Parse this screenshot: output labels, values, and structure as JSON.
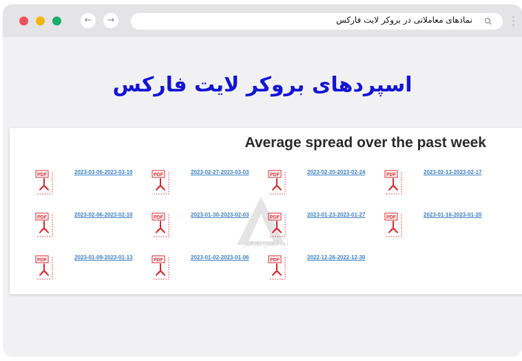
{
  "browser": {
    "address_text": "نمادهای معاملاتی  در  بروکر لایت فارکس"
  },
  "page": {
    "title": "اسپردهای بروکر لایت فارکس",
    "card_title": "Average spread over the past week",
    "watermark_text": "آف آیکس مارکس",
    "files": [
      {
        "label": "2023-03-06-2023-03-10"
      },
      {
        "label": "2023-02-27-2023-03-03"
      },
      {
        "label": "2023-02-20-2023-02-24"
      },
      {
        "label": "2023-02-13-2023-02-17"
      },
      {
        "label": "2023-02-06-2023-02-10"
      },
      {
        "label": "2023-01-30-2023-02-03"
      },
      {
        "label": "2023-01-23-2023-01-27"
      },
      {
        "label": "2023-01-16-2023-01-20"
      },
      {
        "label": "2023-01-09-2023-01-13"
      },
      {
        "label": "2023-01-02-2023-01-06"
      },
      {
        "label": "2022-12-26-2022-12-30"
      }
    ],
    "icon_name": "pdf-file-icon"
  },
  "colors": {
    "title": "#1414d6",
    "link": "#3b7fc0",
    "pdf_red": "#d9262b"
  }
}
